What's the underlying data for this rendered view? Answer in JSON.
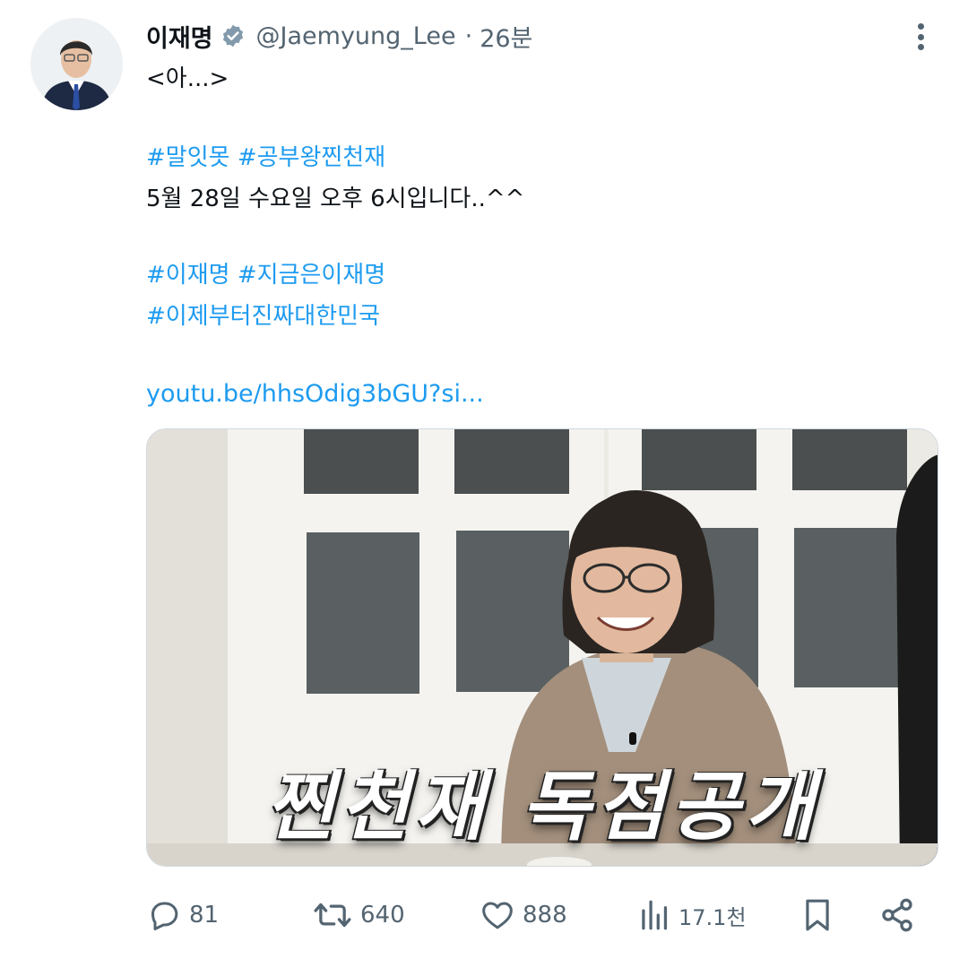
{
  "post": {
    "author_name": "이재명",
    "handle": "@Jaemyung_Lee",
    "separator": "·",
    "time": "26분",
    "body": {
      "line1": "<아...>",
      "hashtags1": [
        "#말잇못",
        "#공부왕찐천재"
      ],
      "line3": "5월 28일 수요일 오후 6시입니다..^^",
      "hashtags2": [
        "#이재명",
        "#지금은이재명"
      ],
      "hashtags3": [
        "#이제부터진짜대한민국"
      ],
      "link": "youtu.be/hhsOdig3bGU?si..."
    },
    "media": {
      "caption": "찐천재 독점공개"
    }
  },
  "actions": {
    "replies": "81",
    "reposts": "640",
    "likes": "888",
    "views": "17.1천"
  },
  "icons": {
    "verified": "verified-badge-icon",
    "more": "more-options-icon",
    "reply": "reply-icon",
    "repost": "repost-icon",
    "like": "heart-icon",
    "views": "views-chart-icon",
    "bookmark": "bookmark-icon",
    "share": "share-icon"
  },
  "colors": {
    "accent": "#1d9bf0",
    "secondary_text": "#536471",
    "primary_text": "#0f1419"
  }
}
